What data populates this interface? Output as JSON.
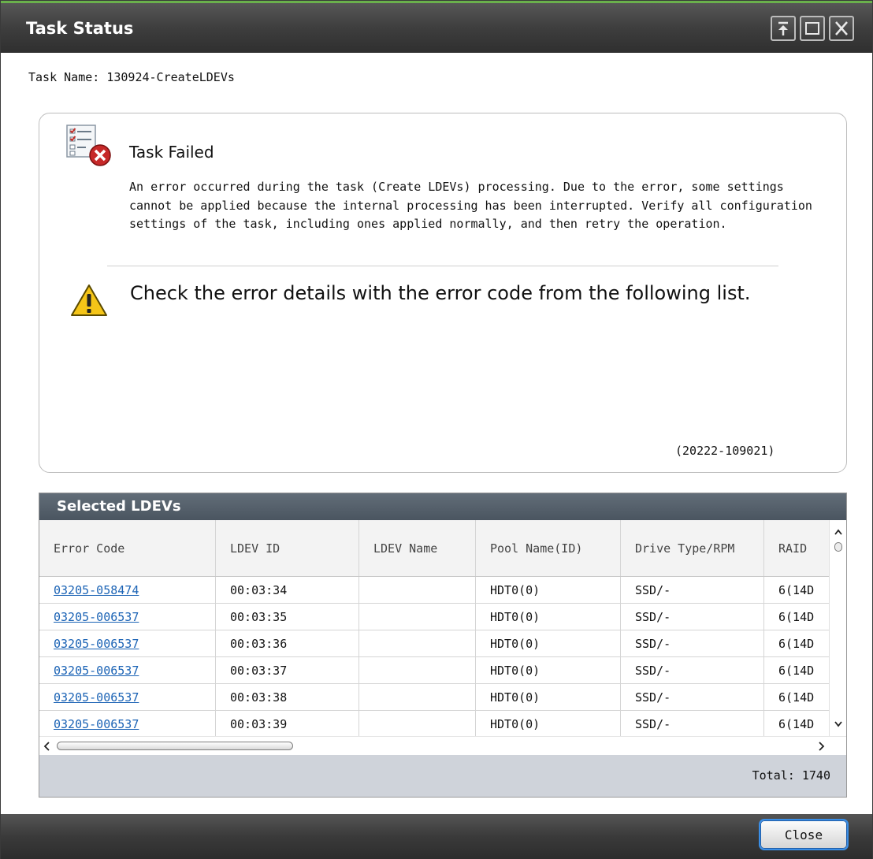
{
  "window": {
    "title": "Task Status",
    "controls": [
      "pin-icon",
      "maximize-icon",
      "close-icon"
    ]
  },
  "task": {
    "name_line": "Task Name: 130924-CreateLDEVs"
  },
  "message": {
    "title": "Task Failed",
    "description": "An error occurred during the task (Create LDEVs) processing. Due to the error, some settings cannot be applied because the internal processing has been interrupted. Verify all configuration settings of the task, including ones applied normally, and then retry the operation.",
    "warning": "Check the error details with the error code from the following list.",
    "code": "(20222-109021)"
  },
  "panel": {
    "title": "Selected LDEVs",
    "columns": [
      "Error Code",
      "LDEV ID",
      "LDEV Name",
      "Pool Name(ID)",
      "Drive Type/RPM",
      "RAID"
    ],
    "rows": [
      [
        "03205-058474",
        "00:03:34",
        "",
        "HDT0(0)",
        "SSD/-",
        "6(14D"
      ],
      [
        "03205-006537",
        "00:03:35",
        "",
        "HDT0(0)",
        "SSD/-",
        "6(14D"
      ],
      [
        "03205-006537",
        "00:03:36",
        "",
        "HDT0(0)",
        "SSD/-",
        "6(14D"
      ],
      [
        "03205-006537",
        "00:03:37",
        "",
        "HDT0(0)",
        "SSD/-",
        "6(14D"
      ],
      [
        "03205-006537",
        "00:03:38",
        "",
        "HDT0(0)",
        "SSD/-",
        "6(14D"
      ],
      [
        "03205-006537",
        "00:03:39",
        "",
        "HDT0(0)",
        "SSD/-",
        "6(14D"
      ]
    ],
    "total": "Total:  1740"
  },
  "footer": {
    "close_label": "Close"
  },
  "colors": {
    "accent_green": "#6ab04c",
    "link": "#1b63b5",
    "focus": "#3a8ee6"
  }
}
